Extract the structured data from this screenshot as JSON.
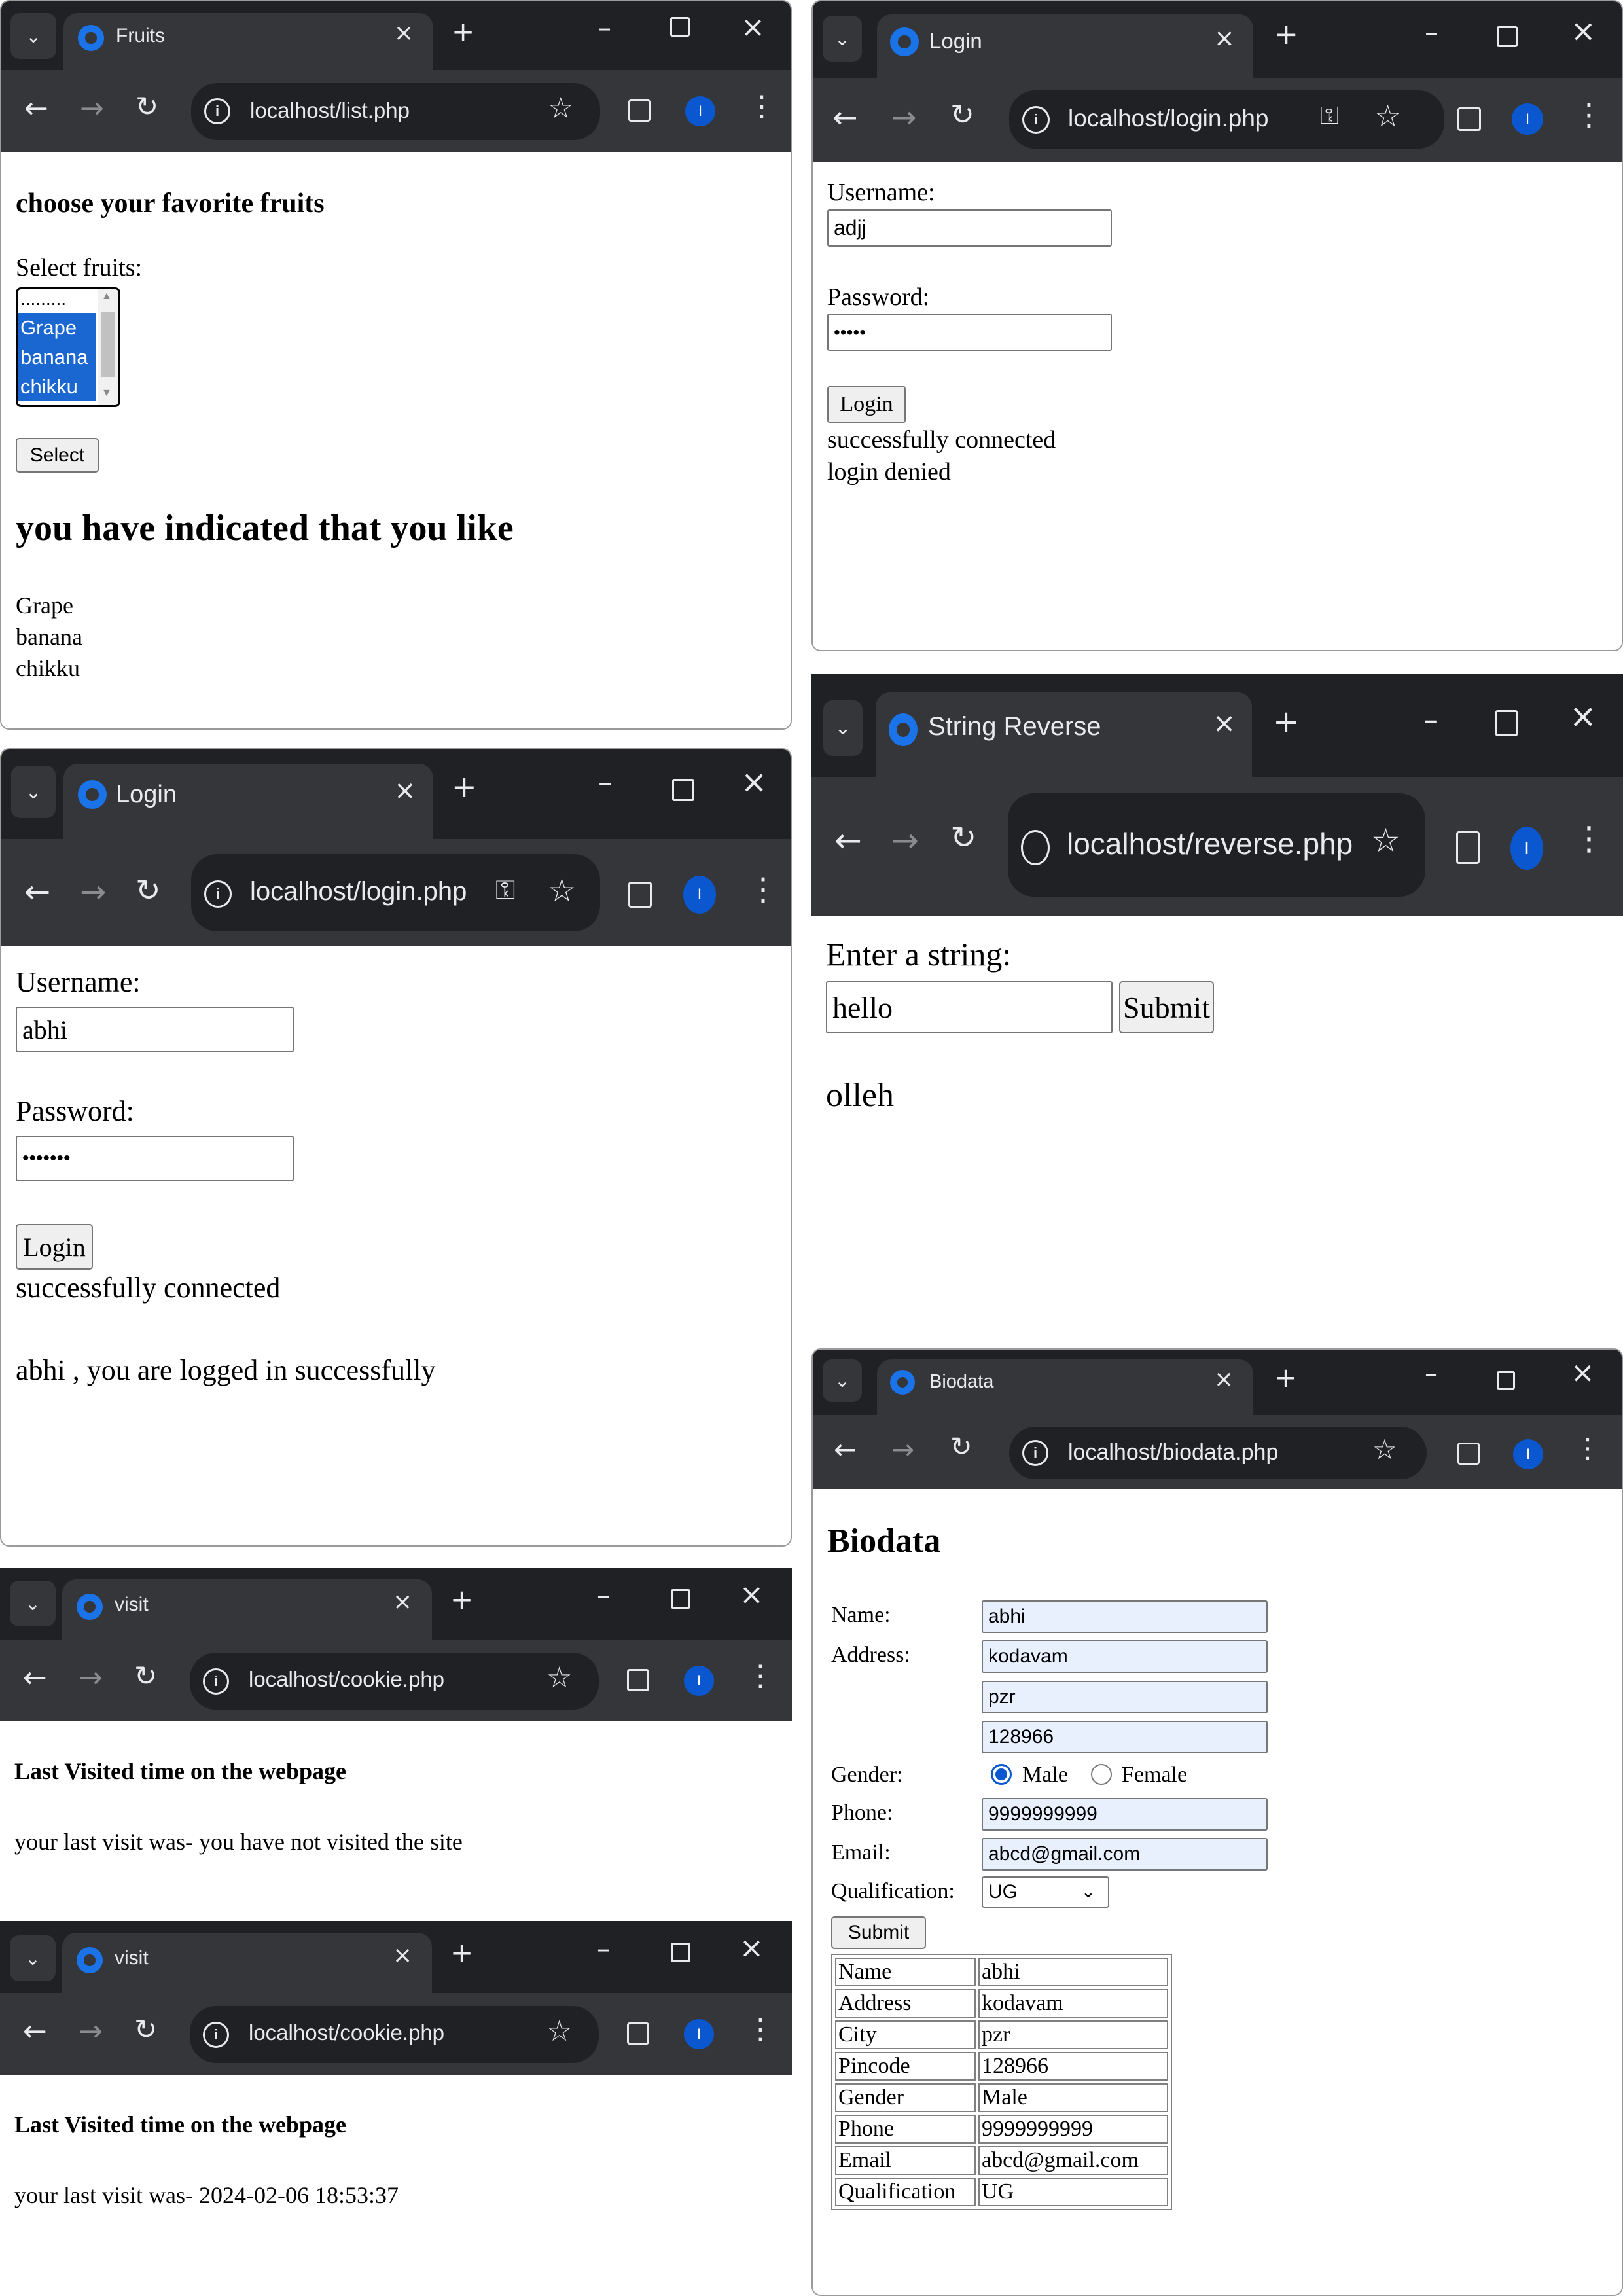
{
  "colors": {
    "chrome_dark": "#202124",
    "chrome_tab": "#35363a",
    "favicon_blue": "#1a73e8",
    "avatar_blue": "#0b57d0",
    "selection_blue": "#1a67d2",
    "autofill_bg": "#e8f0fe"
  },
  "fruits": {
    "tab_title": "Fruits",
    "url": "localhost/list.php",
    "heading": "choose your favorite fruits",
    "select_label": "Select fruits:",
    "options": [
      ".........",
      "Grape",
      "banana",
      "chikku"
    ],
    "select_button": "Select",
    "result_heading": "you have indicated that you like",
    "liked": [
      "Grape",
      "banana",
      "chikku"
    ]
  },
  "login_denied": {
    "tab_title": "Login",
    "url": "localhost/login.php",
    "username_label": "Username:",
    "username_value": "adjj",
    "password_label": "Password:",
    "password_value": "•••••",
    "login_button": "Login",
    "msg_connected": "successfully connected",
    "msg_result": "login denied"
  },
  "login_success": {
    "tab_title": "Login",
    "url": "localhost/login.php",
    "username_label": "Username:",
    "username_value": "abhi",
    "password_label": "Password:",
    "password_value": "•••••••",
    "login_button": "Login",
    "msg_connected": "successfully connected",
    "msg_result": "abhi , you are logged in successfully"
  },
  "reverse": {
    "tab_title": "String Reverse",
    "url": "localhost/reverse.php",
    "label": "Enter a string:",
    "input_value": "hello",
    "submit_button": "Submit",
    "result": "olleh"
  },
  "visit1": {
    "tab_title": "visit",
    "url": "localhost/cookie.php",
    "heading": "Last Visited time on the webpage",
    "message": "your last visit was- you have not visited the site"
  },
  "visit2": {
    "tab_title": "visit",
    "url": "localhost/cookie.php",
    "heading": "Last Visited time on the webpage",
    "message": "your last visit was- 2024-02-06 18:53:37"
  },
  "biodata": {
    "tab_title": "Biodata",
    "url": "localhost/biodata.php",
    "heading": "Biodata",
    "labels": {
      "name": "Name:",
      "address": "Address:",
      "gender": "Gender:",
      "phone": "Phone:",
      "email": "Email:",
      "qualification": "Qualification:"
    },
    "values": {
      "name": "abhi",
      "address1": "kodavam",
      "address2": "pzr",
      "address3": "128966",
      "phone": "9999999999",
      "email": "abcd@gmail.com",
      "qualification": "UG"
    },
    "gender_options": {
      "male": "Male",
      "female": "Female",
      "selected": "Male"
    },
    "submit_button": "Submit",
    "table": [
      [
        "Name",
        "abhi"
      ],
      [
        "Address",
        "kodavam"
      ],
      [
        "City",
        "pzr"
      ],
      [
        "Pincode",
        "128966"
      ],
      [
        "Gender",
        "Male"
      ],
      [
        "Phone",
        "9999999999"
      ],
      [
        "Email",
        "abcd@gmail.com"
      ],
      [
        "Qualification",
        "UG"
      ]
    ]
  },
  "browser": {
    "avatar_letter": "I"
  }
}
